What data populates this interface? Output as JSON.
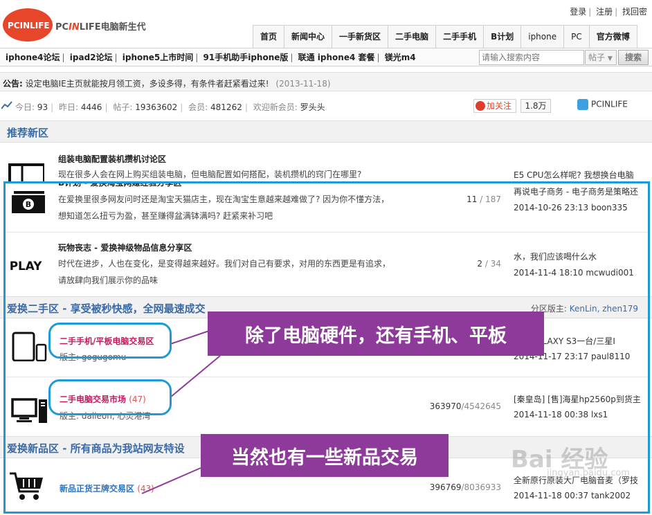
{
  "header": {
    "logo_text": "PCINLIFE",
    "brand_pre": "PC",
    "brand_in": "IN",
    "brand_post": "LIFE电脑新生代",
    "top_links": [
      "登录",
      "注册",
      "找回密"
    ]
  },
  "nav": [
    "首页",
    "新闻中心",
    "一手新货区",
    "二手电脑",
    "二手手机",
    "B计划",
    "iphone",
    "PC",
    "官方微博"
  ],
  "quick_links": [
    "iphone4论坛",
    "ipad2论坛",
    "iphone5上市时间",
    "91手机助手iphone版",
    "联通 iphone4 套餐",
    "镁光m4"
  ],
  "search": {
    "placeholder": "请输入搜索内容",
    "type": "帖子",
    "button": "搜索"
  },
  "notice": {
    "label": "公告:",
    "text": "设定电脑IE主页就能按月领工资，多设多得，有条件者赶紧看过来!",
    "date": "(2013-11-18)"
  },
  "stats": {
    "today_label": "今日:",
    "today": "93",
    "yesterday_label": "昨日:",
    "yesterday": "4446",
    "posts_label": "帖子:",
    "posts": "19363602",
    "members_label": "会员:",
    "members": "481262",
    "welcome_label": "欢迎新会员:",
    "welcome_user": "罗头头"
  },
  "weibo": {
    "follow": "加关注",
    "count": "1.8万",
    "name": "PCINLIFE"
  },
  "sections": {
    "recommended": {
      "title": "推荐新区"
    },
    "used": {
      "title": "爱换二手区 - 享受被秒快感，全网最速成交",
      "mod_label": "分区版主:",
      "mods": "KenLin, zhen179"
    },
    "new": {
      "title": "爱换新品区 - 所有商品为我站网友特设"
    }
  },
  "forums": {
    "assembly": {
      "title": "组装电脑配置装机攒机讨论区",
      "desc": "现在很多人会在网上购买组装电脑，但电脑配置如何搭配，装机攒机的窍门在哪里?",
      "last_title": "E5 CPU怎么样呢? 我想换台电脑"
    },
    "bplan": {
      "title": "B计划 - 爱换淘宝网赚经验分享区",
      "desc": "在爱换里很多网友问时还是淘宝天猫店主，现在淘宝生意越来越难做了? 因为你不懂方法，想知道怎么扭亏为盈，甚至赚得盆满钵满吗? 赶紧来补习吧",
      "topics": "11",
      "posts": "187",
      "last_title": "再说电子商务 - 电子商务是策略还",
      "last_meta": "2014-10-26 23:13 boon335"
    },
    "play": {
      "title": "玩物丧志 - 爱换神级物品信息分享区",
      "desc": "时代在进步，人也在变化，是变得越来越好。我们对自己有要求，对用的东西更是有追求，请放肆向我们展示你的品味",
      "topics": "2",
      "posts": "34",
      "last_title": "水，我们应该喝什么水",
      "last_meta": "2014-11-4 18:10 mcwudi001"
    },
    "phone": {
      "title": "二手手机/平板电脑交易区",
      "mod": "版主: gogugomu",
      "last_title": "三星GALAXY S3一台/三星I",
      "last_meta": "2014-11-17 23:17 paul8110"
    },
    "pc": {
      "title": "二手电脑交易市场",
      "count": "(47)",
      "mod": "版主: dalleon, 心灵港湾",
      "topics": "363970",
      "posts": "4542645",
      "last_title": "[秦皇岛] [售]海星hp2560p到货主",
      "last_meta": "2014-11-18 00:38 lxs1"
    },
    "genuine": {
      "title": "新品正货王牌交易区",
      "count": "(43)",
      "topics": "396769",
      "posts": "8036933",
      "last_title": "全新原行原装大厂电脑音麦（罗技",
      "last_meta": "2014-11-18 00:37 tank2002"
    }
  },
  "callouts": {
    "first": "除了电脑硬件，还有手机、平板",
    "second": "当然也有一些新品交易"
  },
  "watermark": {
    "main": "Bai 经验",
    "sub": "jingyan.baidu.com"
  },
  "icons": {
    "assembly": "pc-case-icon",
    "bplan": "banknote-icon",
    "play": "play-text-icon",
    "phone": "phone-tablet-icon",
    "pc": "desktop-computer-icon",
    "genuine": "shopping-cart-icon"
  },
  "play_icon_text": "PLAY"
}
